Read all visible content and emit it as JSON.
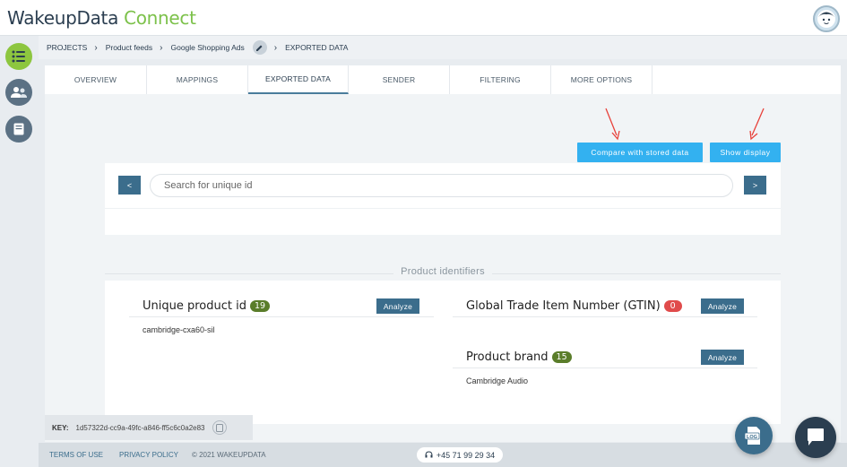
{
  "header": {
    "logo_word1": "WakeupData",
    "logo_word2": "Connect"
  },
  "sidebar": {
    "items": [
      {
        "icon": "list-icon",
        "active": true
      },
      {
        "icon": "users-icon",
        "active": false
      },
      {
        "icon": "book-icon",
        "active": false
      }
    ]
  },
  "breadcrumb": {
    "items": [
      "PROJECTS",
      "Product feeds",
      "Google Shopping Ads",
      "EXPORTED DATA"
    ]
  },
  "tabs": {
    "items": [
      "OVERVIEW",
      "MAPPINGS",
      "EXPORTED DATA",
      "SENDER",
      "FILTERING",
      "MORE OPTIONS"
    ],
    "active": "EXPORTED DATA"
  },
  "actions": {
    "compare_label": "Compare with stored data",
    "show_label": "Show display"
  },
  "search": {
    "prev_label": "<",
    "next_label": ">",
    "placeholder": "Search for unique id"
  },
  "section": {
    "title": "Product identifiers"
  },
  "fields": [
    {
      "label": "Unique product id",
      "count": "19",
      "count_color": "#5a7d2a",
      "analyze_label": "Analyze",
      "value": "cambridge-cxa60-sil"
    },
    {
      "label": "Global Trade Item Number (GTIN)",
      "count": "0",
      "count_color": "#e04b4b",
      "analyze_label": "Analyze",
      "value": ""
    },
    {
      "label": "Product brand",
      "count": "15",
      "count_color": "#5a7d2a",
      "analyze_label": "Analyze",
      "value": "Cambridge Audio"
    }
  ],
  "key": {
    "label": "KEY:",
    "value": "1d57322d-cc9a-49fc-a846-ff5c6c0a2e83"
  },
  "footer": {
    "terms": "TERMS OF USE",
    "privacy": "PRIVACY POLICY",
    "copyright": "© 2021 WAKEUPDATA",
    "phone": "+45 71 99 29 34"
  },
  "fab": {
    "log_label": "LOG"
  },
  "colors": {
    "accent_green": "#8dc63f",
    "primary_blue": "#33b1f0",
    "dark_blue": "#3b6d8c",
    "annotation_red": "#e8413a"
  }
}
